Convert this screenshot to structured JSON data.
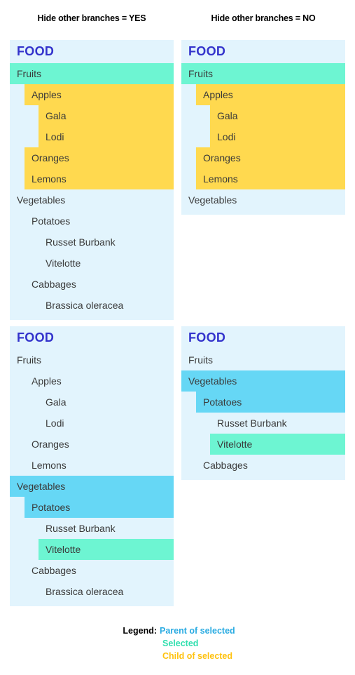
{
  "headers": {
    "left": "Hide other branches = YES",
    "right": "Hide other branches = NO"
  },
  "colors": {
    "panel_background": "#e2f4fd",
    "selected": "#6df5d2",
    "parent_of_selected": "#66d7f5",
    "child_of_selected": "#ffd94f",
    "root_title": "#3333cc",
    "row_text": "#3a3a3a",
    "legend_parent": "#29abe2",
    "legend_selected": "#2fdfae",
    "legend_child": "#ffc20e"
  },
  "panels": [
    {
      "id": "top-left",
      "title": "FOOD",
      "rows": [
        {
          "label": "Fruits",
          "indent": 0,
          "state": "selected"
        },
        {
          "label": "Apples",
          "indent": 1,
          "state": "child"
        },
        {
          "label": "Gala",
          "indent": 2,
          "state": "child"
        },
        {
          "label": "Lodi",
          "indent": 2,
          "state": "child"
        },
        {
          "label": "Oranges",
          "indent": 1,
          "state": "child"
        },
        {
          "label": "Lemons",
          "indent": 1,
          "state": "child"
        },
        {
          "label": "Vegetables",
          "indent": 0,
          "state": "none"
        },
        {
          "label": "Potatoes",
          "indent": 1,
          "state": "none"
        },
        {
          "label": "Russet Burbank",
          "indent": 2,
          "state": "none"
        },
        {
          "label": "Vitelotte",
          "indent": 2,
          "state": "none"
        },
        {
          "label": "Cabbages",
          "indent": 1,
          "state": "none"
        },
        {
          "label": "Brassica oleracea",
          "indent": 2,
          "state": "none"
        }
      ]
    },
    {
      "id": "top-right",
      "title": "FOOD",
      "rows": [
        {
          "label": "Fruits",
          "indent": 0,
          "state": "selected"
        },
        {
          "label": "Apples",
          "indent": 1,
          "state": "child"
        },
        {
          "label": "Gala",
          "indent": 2,
          "state": "child"
        },
        {
          "label": "Lodi",
          "indent": 2,
          "state": "child"
        },
        {
          "label": "Oranges",
          "indent": 1,
          "state": "child"
        },
        {
          "label": "Lemons",
          "indent": 1,
          "state": "child"
        },
        {
          "label": "Vegetables",
          "indent": 0,
          "state": "none"
        }
      ]
    },
    {
      "id": "bottom-left",
      "title": "FOOD",
      "rows": [
        {
          "label": "Fruits",
          "indent": 0,
          "state": "none"
        },
        {
          "label": "Apples",
          "indent": 1,
          "state": "none"
        },
        {
          "label": "Gala",
          "indent": 2,
          "state": "none"
        },
        {
          "label": "Lodi",
          "indent": 2,
          "state": "none"
        },
        {
          "label": "Oranges",
          "indent": 1,
          "state": "none"
        },
        {
          "label": "Lemons",
          "indent": 1,
          "state": "none"
        },
        {
          "label": "Vegetables",
          "indent": 0,
          "state": "parent"
        },
        {
          "label": "Potatoes",
          "indent": 1,
          "state": "parent"
        },
        {
          "label": "Russet Burbank",
          "indent": 2,
          "state": "none"
        },
        {
          "label": "Vitelotte",
          "indent": 2,
          "state": "selected"
        },
        {
          "label": "Cabbages",
          "indent": 1,
          "state": "none"
        },
        {
          "label": "Brassica oleracea",
          "indent": 2,
          "state": "none"
        }
      ]
    },
    {
      "id": "bottom-right",
      "title": "FOOD",
      "rows": [
        {
          "label": "Fruits",
          "indent": 0,
          "state": "none"
        },
        {
          "label": "Vegetables",
          "indent": 0,
          "state": "parent"
        },
        {
          "label": "Potatoes",
          "indent": 1,
          "state": "parent"
        },
        {
          "label": "Russet Burbank",
          "indent": 2,
          "state": "none"
        },
        {
          "label": "Vitelotte",
          "indent": 2,
          "state": "selected"
        },
        {
          "label": "Cabbages",
          "indent": 1,
          "state": "none"
        }
      ]
    }
  ],
  "legend": {
    "label": "Legend:",
    "entries": [
      {
        "text": "Parent of selected",
        "state": "parent"
      },
      {
        "text": "Selected",
        "state": "selected"
      },
      {
        "text": "Child of selected",
        "state": "child"
      }
    ]
  }
}
